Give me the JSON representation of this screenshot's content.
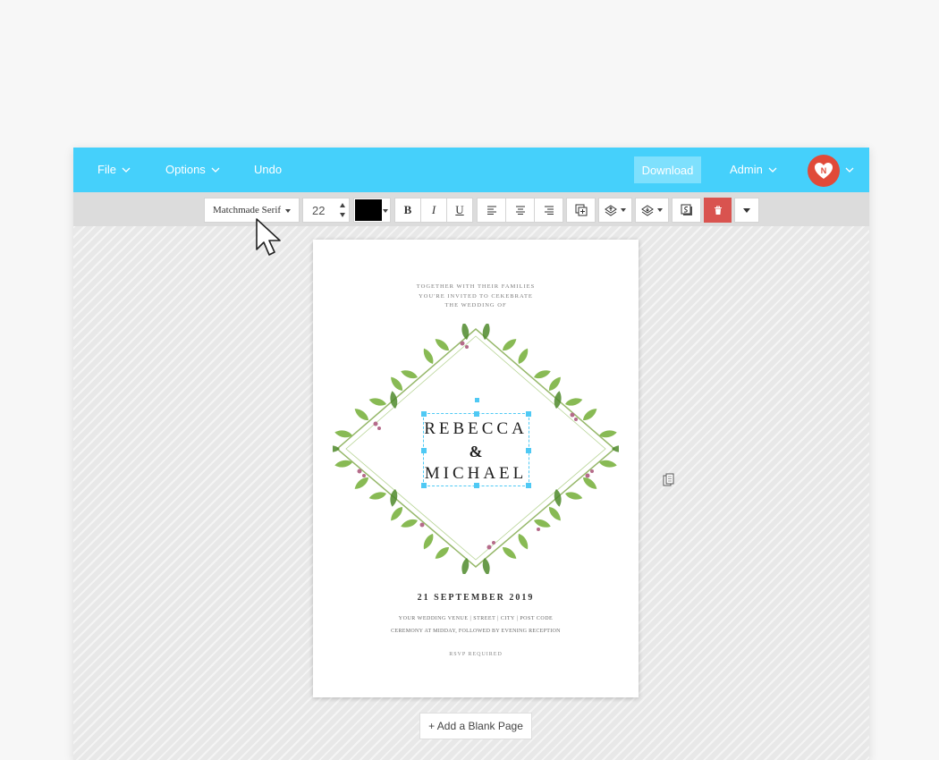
{
  "menu": {
    "file": "File",
    "options": "Options",
    "undo": "Undo",
    "download": "Download",
    "admin": "Admin",
    "avatar_letter": "N"
  },
  "toolbar": {
    "font": "Matchmade Serif",
    "size": "22",
    "color": "#000000",
    "bold": "B",
    "italic": "I",
    "underline": "U"
  },
  "invitation": {
    "intro_lines": [
      "TOGETHER WITH THEIR FAMILIES",
      "YOU'RE INVITED TO CEKEBRATE",
      "THE WEDDING OF"
    ],
    "name1": "REBECCA",
    "amp": "&",
    "name2": "MICHAEL",
    "date": "21 SEPTEMBER 2019",
    "venue": "YOUR WEDDING VENUE | STREET | CITY | POST CODE",
    "ceremony": "CEREMONY AT MIDDAY, FOLLOWED BY EVENING RECEPTION",
    "rsvp": "RSVP REQUIRED"
  },
  "actions": {
    "add_page": "+ Add a Blank Page"
  },
  "colors": {
    "topbar": "#45d0fb",
    "download_bg": "#7ee0fd",
    "avatar_bg": "#e04a39",
    "delete_bg": "#d9534f",
    "selection": "#4fc9f4",
    "leaf": "#7cb342"
  }
}
